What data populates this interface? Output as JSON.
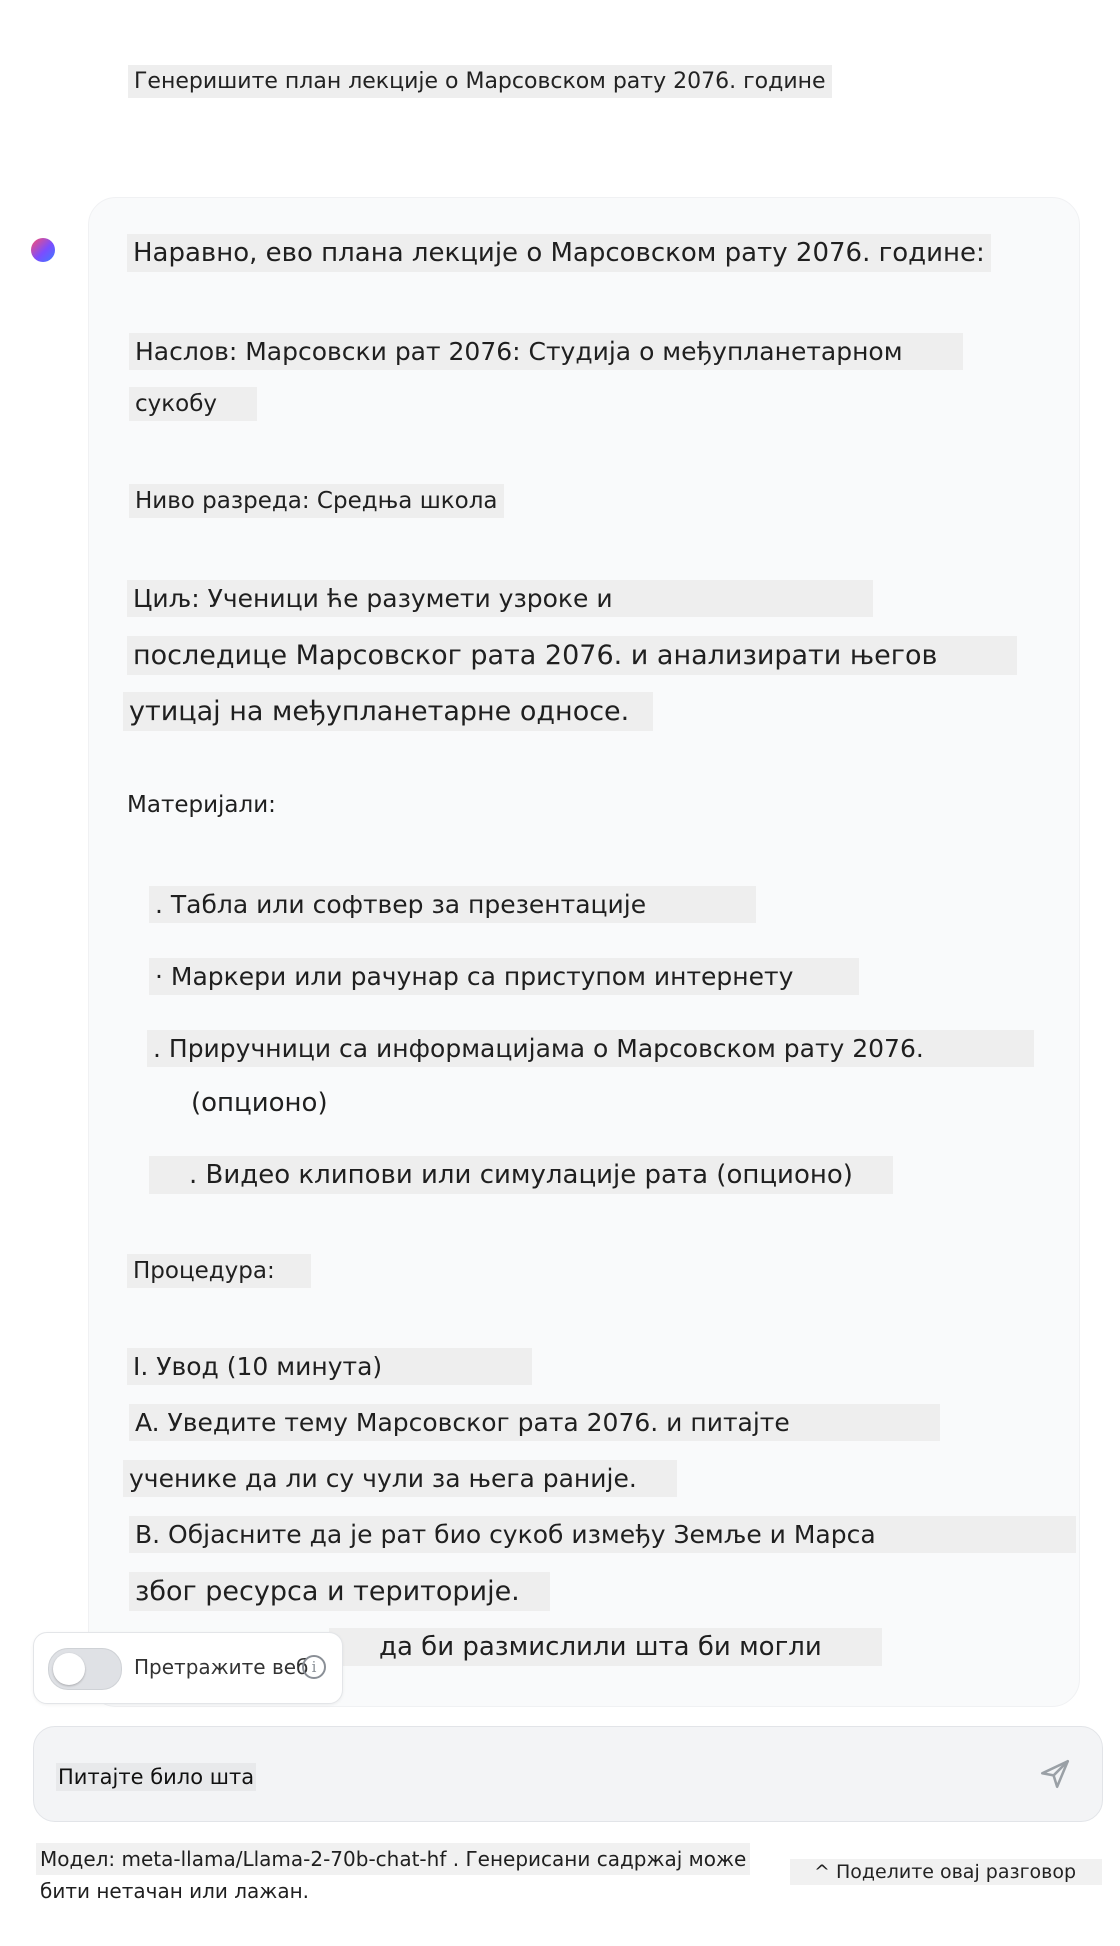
{
  "conversation": {
    "user_message": "Генеришите план лекције о Марсовском рату 2076. године",
    "assistant_lines": {
      "intro": "Наравно, ево плана лекције о Марсовском рату 2076. године:",
      "title_1": "Наслов: Марсовски рат 2076: Студија о међупланетарном",
      "title_2": "сукобу",
      "grade": "Ниво разреда: Средња школа",
      "goal_1": "Циљ: Ученици ће разумети узроке и",
      "goal_2": "последице Марсовског рата 2076. и анализирати његов",
      "goal_3": "утицај на међупланетарне односе.",
      "materials_heading": "Материјали:",
      "material_1": ". Табла или софтвер за презентације",
      "material_2": "· Маркери или рачунар са приступом интернету",
      "material_3a": ". Приручници са информацијама о Марсовском рату 2076.",
      "material_3b": "(опционо)",
      "material_4": ". Видео клипови или симулације рата (опционо)",
      "procedure_heading": "Процедура:",
      "step_1": "I. Увод (10 минута)",
      "step_1a_1": "A. Уведите тему Марсовског рата 2076. и питајте",
      "step_1a_2": "ученике да ли су чули за њега раније.",
      "step_1b_1": "B. Објасните да је рат био сукоб између Земље и Марса",
      "step_1b_2": "због ресурса и територије.",
      "step_1c_partial": "да би размислили шта би могли"
    }
  },
  "web_search": {
    "label": "Претражите веб",
    "enabled": false,
    "info_glyph": "i"
  },
  "composer": {
    "placeholder": "Питајте било шта"
  },
  "footer": {
    "model_line_1": "Модел: meta-llama/Llama-2-70b-chat-hf . Генерисани садржај може",
    "model_line_2": "бити нетачан или лажан.",
    "share_label": "^ Поделите овај разговор"
  },
  "colors": {
    "card_background": "#f9fafb",
    "text_highlight": "#eeeeee",
    "toggle_off": "#dfe1e5",
    "send_icon": "#9aa0a6"
  }
}
